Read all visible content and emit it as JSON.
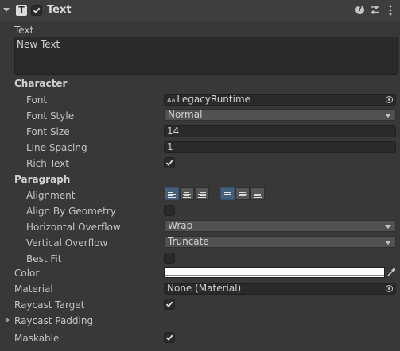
{
  "header": {
    "component_title": "Text",
    "enabled": true,
    "icons": [
      "foldout-arrow-icon",
      "text-component-icon",
      "help-icon",
      "presets-icon",
      "more-options-icon"
    ]
  },
  "text_section": {
    "label": "Text",
    "value": "New Text"
  },
  "character": {
    "heading": "Character",
    "font_label": "Font",
    "font_prefix": "Aa",
    "font_value": "LegacyRuntime",
    "font_style_label": "Font Style",
    "font_style_value": "Normal",
    "font_size_label": "Font Size",
    "font_size_value": "14",
    "line_spacing_label": "Line Spacing",
    "line_spacing_value": "1",
    "rich_text_label": "Rich Text",
    "rich_text_checked": true
  },
  "paragraph": {
    "heading": "Paragraph",
    "alignment_label": "Alignment",
    "horizontal_alignment_selected": "left",
    "vertical_alignment_selected": "top",
    "align_by_geometry_label": "Align By Geometry",
    "align_by_geometry_checked": false,
    "horizontal_overflow_label": "Horizontal Overflow",
    "horizontal_overflow_value": "Wrap",
    "vertical_overflow_label": "Vertical Overflow",
    "vertical_overflow_value": "Truncate",
    "best_fit_label": "Best Fit",
    "best_fit_checked": false
  },
  "color": {
    "label": "Color",
    "value_hex": "#FFFFFF"
  },
  "material": {
    "label": "Material",
    "value": "None (Material)"
  },
  "raycast_target": {
    "label": "Raycast Target",
    "checked": true
  },
  "raycast_padding": {
    "label": "Raycast Padding"
  },
  "maskable": {
    "label": "Maskable",
    "checked": true
  },
  "colors": {
    "background": "#383838",
    "header": "#3e3e3e",
    "field": "#2a2a2a",
    "selected_toggle": "#46607c"
  }
}
